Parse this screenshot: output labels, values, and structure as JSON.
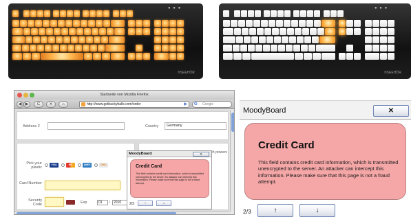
{
  "keyboards": {
    "left_brand": "®SEEHÖR",
    "right_brand": "®SEEHÖR"
  },
  "browser": {
    "window_title": "Startseite von Mozilla Firefox",
    "nav": {
      "back": "◀",
      "forward": "▶",
      "reload": "C",
      "stop": "✕",
      "home": "⌂"
    },
    "url": "http://www.getbackyballs.com/order",
    "go": "▶",
    "search_engine_glyph": "G",
    "search_placeholder": "Google",
    "form": {
      "address2_label": "Address 2",
      "address2_value": "",
      "country_label": "Country",
      "country_value": "Germany",
      "pick_plastic_label": "Pick your plastic",
      "card_brands": [
        "VISA",
        "MC",
        "AMEX",
        "DISC"
      ],
      "card_number_label": "Card Number",
      "card_number_value": "",
      "security_code_label": "Security Code",
      "security_code_value": "",
      "exp_label": "Exp",
      "exp_month": "01",
      "exp_separator": "/",
      "exp_year": "2010",
      "right_panel_text": "I understand that fluorobalts are high powered ma"
    },
    "mini_moodyboard": {
      "title": "MoodyBoard",
      "close_label": "✕",
      "heading": "Credit Card",
      "body": "This field contains credit card information, which is transmitted unencrypted to the server. An attacker can intercept this information. Please make sure that this page is not a fraud attempt.",
      "pager": "2/3",
      "up_label": "↑",
      "down_label": "↓"
    }
  },
  "moodyboard": {
    "title": "MoodyBoard",
    "close_label": "✕",
    "heading": "Credit Card",
    "body": "This field contains credit card information, which is transmitted unencrypted to the server. An attacker can intercept this information. Please make sure that this page is not a fraud attempt.",
    "pager": "2/3",
    "up_label": "↑",
    "down_label": "↓",
    "colors": {
      "alert_background": "#f5a7a7",
      "alert_border": "#b88080",
      "button_border": "#6f86b6"
    }
  },
  "colors": {
    "key_glow": "#ffb54c",
    "key_white": "#ffffff",
    "keyboard_body": "#111111",
    "highlight_field": "#fff8c4",
    "scrollbar_thumb": "#7fa3d8"
  }
}
